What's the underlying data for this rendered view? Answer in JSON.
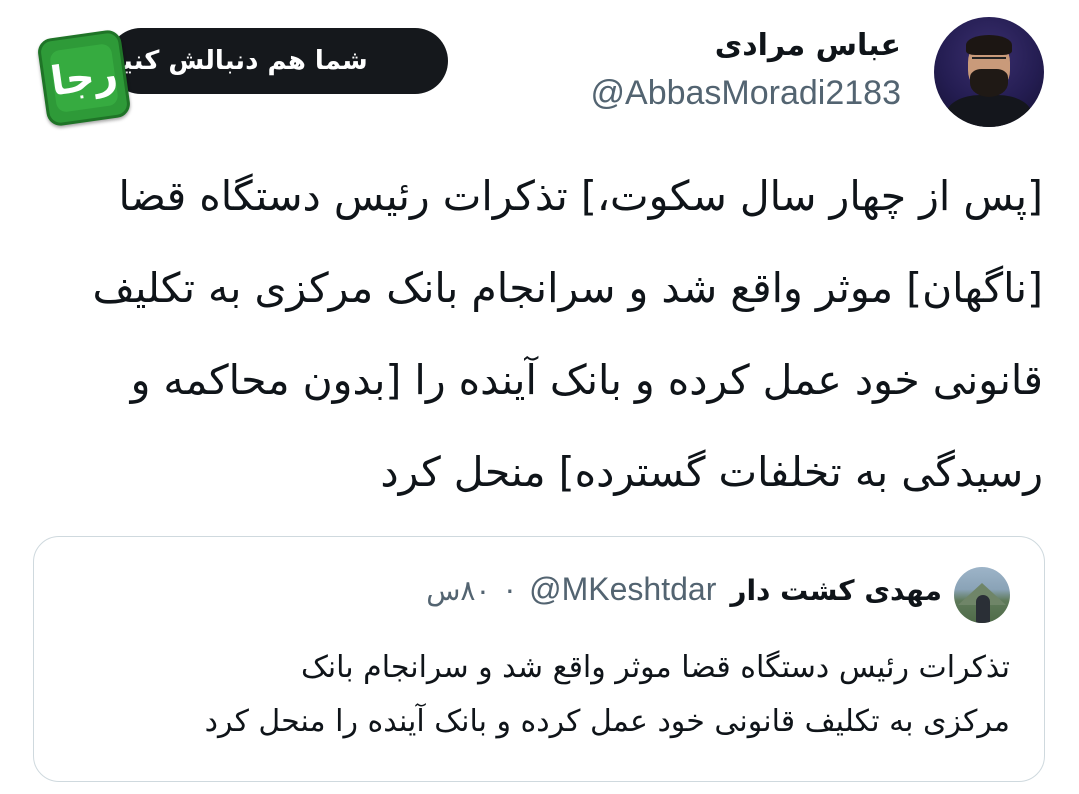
{
  "author": {
    "display_name": "عباس مرادی",
    "handle": "@AbbasMoradi2183",
    "avatar_icon": "profile-photo"
  },
  "promo": {
    "follow_label": "شما هم دنبالش کنید",
    "logo_text": "رجا",
    "logo_color": "#2e9a38",
    "pill_color": "#15181c"
  },
  "tweet": {
    "lines": [
      "[پس از چهار سال سکوت،] تذکرات رئیس دستگاه قضا",
      "[ناگهان] موثر واقع شد و سرانجام بانک مرکزی به تکلیف",
      "قانونی خود عمل کرده و بانک آینده را [بدون محاکمه و",
      "رسیدگی به تخلفات گسترده] منحل کرد"
    ]
  },
  "quoted": {
    "display_name": "مهدی کشت دار",
    "handle": "@MKeshtdar",
    "separator": "·",
    "time": "۸۰س",
    "lines": [
      "تذکرات رئیس دستگاه قضا موثر واقع شد و سرانجام بانک",
      "مرکزی به تکلیف قانونی خود عمل کرده و بانک آینده را منحل کرد"
    ]
  },
  "colors": {
    "text_primary": "#0f1419",
    "text_secondary": "#536471",
    "card_border": "#cfd9de"
  }
}
